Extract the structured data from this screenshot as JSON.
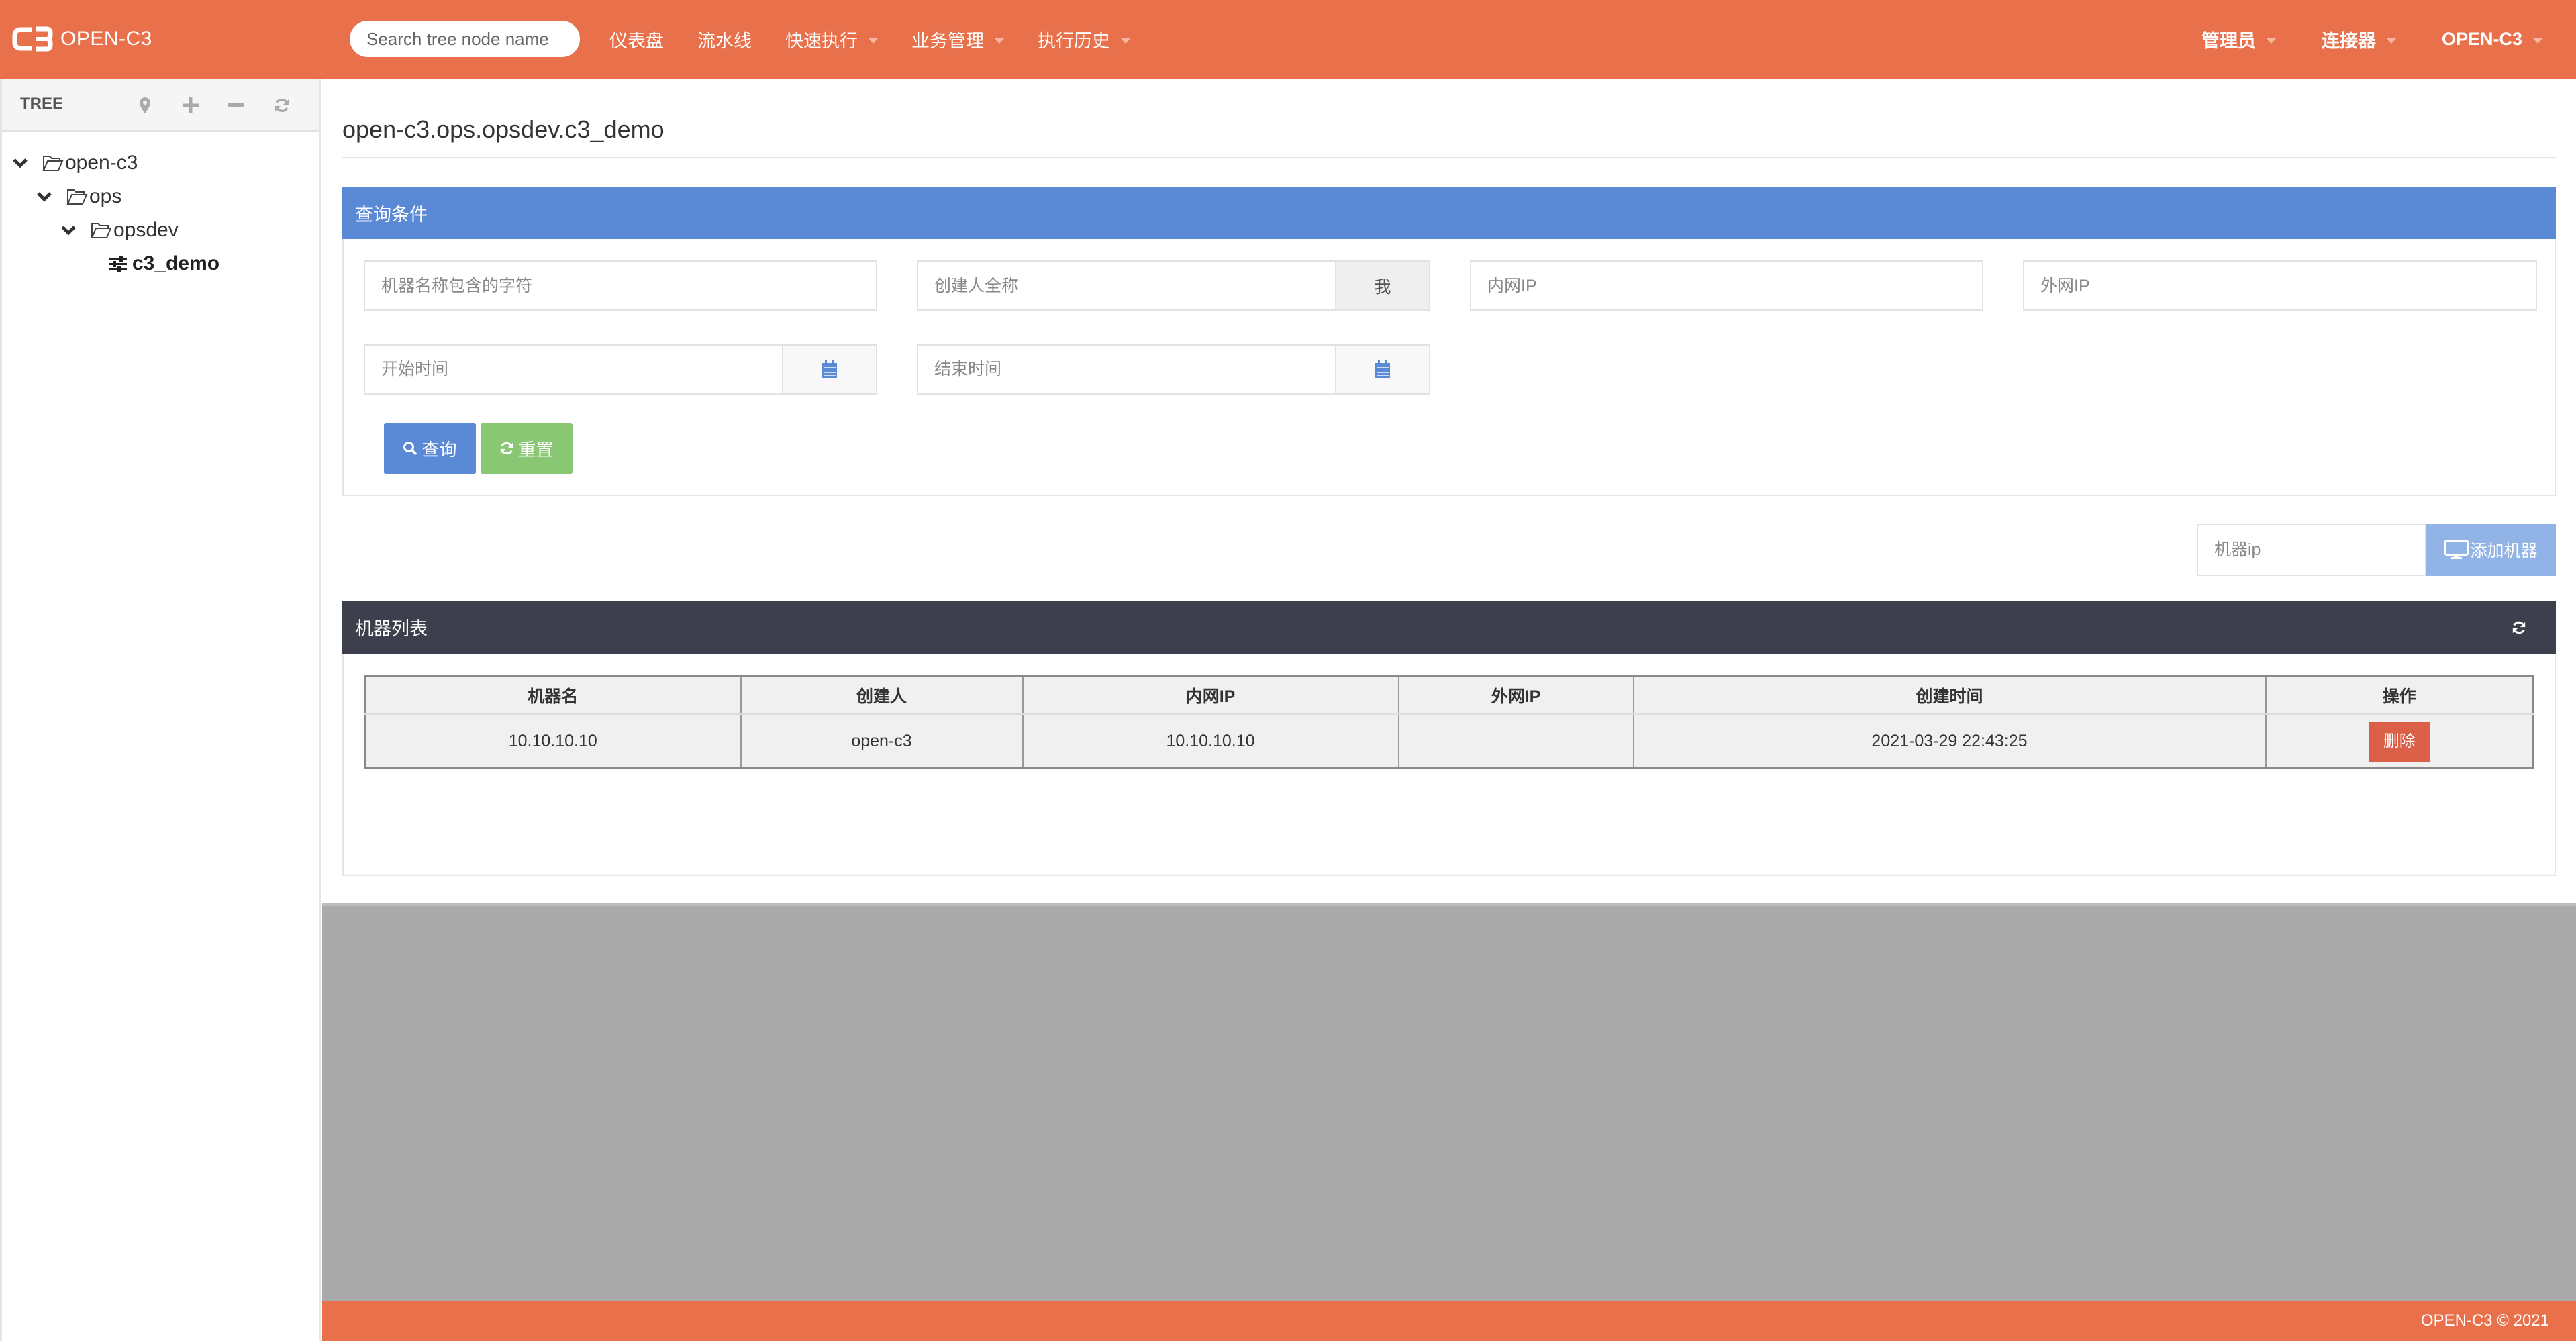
{
  "app": {
    "logo_text": "OPEN-C3",
    "search": {
      "placeholder": "Search tree node name",
      "value": ""
    }
  },
  "nav": {
    "left": [
      {
        "label": "仪表盘",
        "dropdown": false
      },
      {
        "label": "流水线",
        "dropdown": false
      },
      {
        "label": "快速执行",
        "dropdown": true
      },
      {
        "label": "业务管理",
        "dropdown": true
      },
      {
        "label": "执行历史",
        "dropdown": true
      }
    ],
    "right": [
      {
        "label": "管理员",
        "dropdown": true
      },
      {
        "label": "连接器",
        "dropdown": true
      },
      {
        "label": "OPEN-C3",
        "dropdown": true
      }
    ]
  },
  "sidebar": {
    "title": "TREE",
    "tools": [
      "map-marker-icon",
      "plus-icon",
      "minus-icon",
      "refresh-icon"
    ],
    "nodes": [
      {
        "label": "open-c3",
        "level": 0,
        "type": "folder",
        "expanded": true
      },
      {
        "label": "ops",
        "level": 1,
        "type": "folder",
        "expanded": true
      },
      {
        "label": "opsdev",
        "level": 2,
        "type": "folder",
        "expanded": true
      },
      {
        "label": "c3_demo",
        "level": 3,
        "type": "leaf",
        "selected": true
      }
    ]
  },
  "main": {
    "title": "open-c3.ops.opsdev.c3_demo",
    "query": {
      "heading": "查询条件",
      "machine_name": {
        "placeholder": "机器名称包含的字符",
        "value": ""
      },
      "creator": {
        "placeholder": "创建人全称",
        "value": "",
        "me_label": "我"
      },
      "inner_ip": {
        "placeholder": "内网IP",
        "value": ""
      },
      "outer_ip": {
        "placeholder": "外网IP",
        "value": ""
      },
      "start_time": {
        "placeholder": "开始时间",
        "value": ""
      },
      "end_time": {
        "placeholder": "结束时间",
        "value": ""
      },
      "query_label": "查询",
      "reset_label": "重置"
    },
    "add_machine": {
      "placeholder": "机器ip",
      "value": "",
      "button_label": "添加机器"
    },
    "machine_list": {
      "heading": "机器列表",
      "columns": [
        "机器名",
        "创建人",
        "内网IP",
        "外网IP",
        "创建时间",
        "操作"
      ],
      "rows": [
        {
          "name": "10.10.10.10",
          "creator": "open-c3",
          "inner_ip": "10.10.10.10",
          "outer_ip": "",
          "created": "2021-03-29 22:43:25",
          "action_label": "删除"
        }
      ]
    }
  },
  "footer": {
    "text": "OPEN-C3 © 2021"
  },
  "colors": {
    "brand": "#E8704A",
    "primary": "#5A8AD6",
    "success": "#89C774",
    "danger": "#DC5F48",
    "dark_panel": "#3D404C"
  }
}
